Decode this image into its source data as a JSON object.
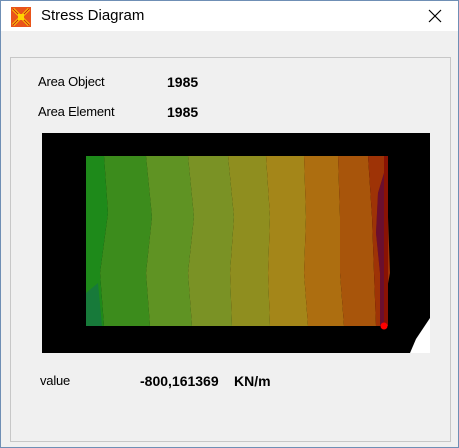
{
  "window": {
    "title": "Stress Diagram",
    "icon": "sap2000-app-icon",
    "close_icon": "close-icon"
  },
  "info": {
    "area_object_label": "Area Object",
    "area_object_value": "1985",
    "area_element_label": "Area Element",
    "area_element_value": "1985"
  },
  "result": {
    "value_label": "value",
    "value_text": "-800,161369",
    "unit": "KN/m"
  },
  "diagram": {
    "type": "contour",
    "band_colors": [
      "#1e8a1a",
      "#3c8c1c",
      "#5f9323",
      "#7a9225",
      "#8f8e1f",
      "#a48619",
      "#ad6e10",
      "#a8550b",
      "#9e3306",
      "#8a1203",
      "#6a0f2e"
    ],
    "marker_color": "#ff0000",
    "background": "#000000"
  }
}
